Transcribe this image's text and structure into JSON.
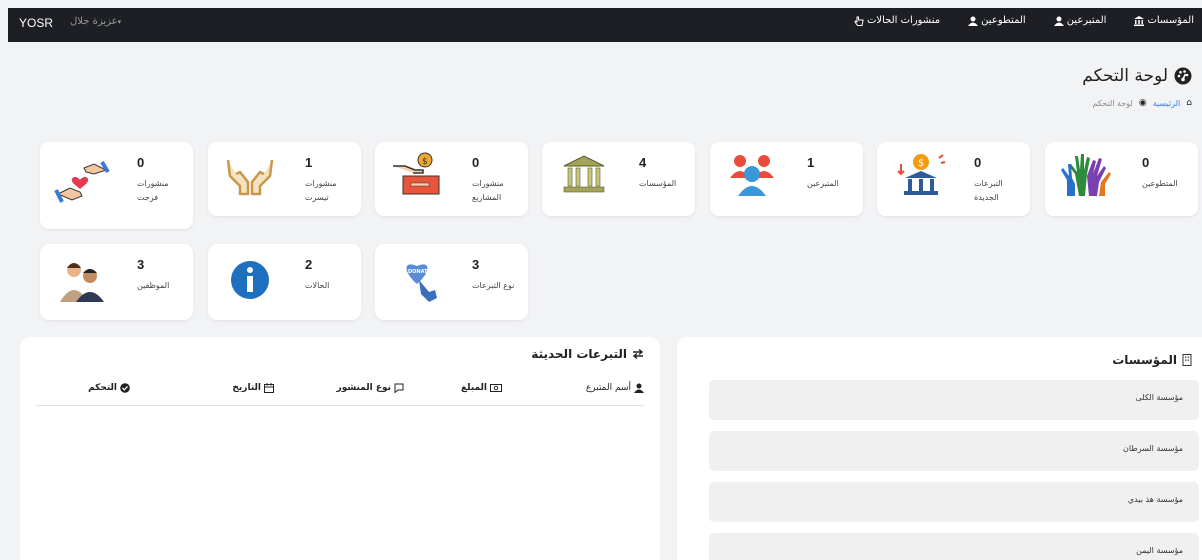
{
  "topbar": {
    "brand": "YOSR",
    "user": "عزيزة جلال",
    "nav": [
      "المؤسسات",
      "المتبرعين",
      "المتطوعين",
      "منشورات الحالات"
    ]
  },
  "header": {
    "title": "لوحة التحكم",
    "breadcrumb_home": "الرئيسية",
    "breadcrumb_current": "لوحة التحكم"
  },
  "cards": [
    {
      "count": "0",
      "label": "المتطوعين",
      "icon": "volunteer-hands-icon"
    },
    {
      "count": "0",
      "label": "التبرعات الجديدة",
      "icon": "donation-bank-icon"
    },
    {
      "count": "1",
      "label": "المتبرعين",
      "icon": "donors-people-icon"
    },
    {
      "count": "4",
      "label": "المؤسسات",
      "icon": "institution-building-icon"
    },
    {
      "count": "0",
      "label": "منشورات المشاريع",
      "icon": "project-coin-box-icon"
    },
    {
      "count": "1",
      "label": "منشورات تيسرت",
      "icon": "open-hands-icon"
    },
    {
      "count": "0",
      "label": "منشورات فرجت",
      "icon": "heart-handshake-icon"
    },
    {
      "count": "3",
      "label": "نوع التبرعات",
      "icon": "donate-heart-icon"
    },
    {
      "count": "2",
      "label": "الحالات",
      "icon": "info-icon"
    },
    {
      "count": "3",
      "label": "الموظفين",
      "icon": "employees-icon"
    }
  ],
  "institutions": {
    "title": "المؤسسات",
    "items": [
      "مؤسسة الكلى",
      "مؤسسة السرطان",
      "مؤسسة هذ بيدي",
      "مؤسسة اليمن"
    ]
  },
  "donations": {
    "title": "التبرعات الحديثة",
    "columns": [
      "أسم المتبرع",
      "المبلغ",
      "نوع المنشور",
      "التاريخ",
      "التحكم"
    ]
  }
}
